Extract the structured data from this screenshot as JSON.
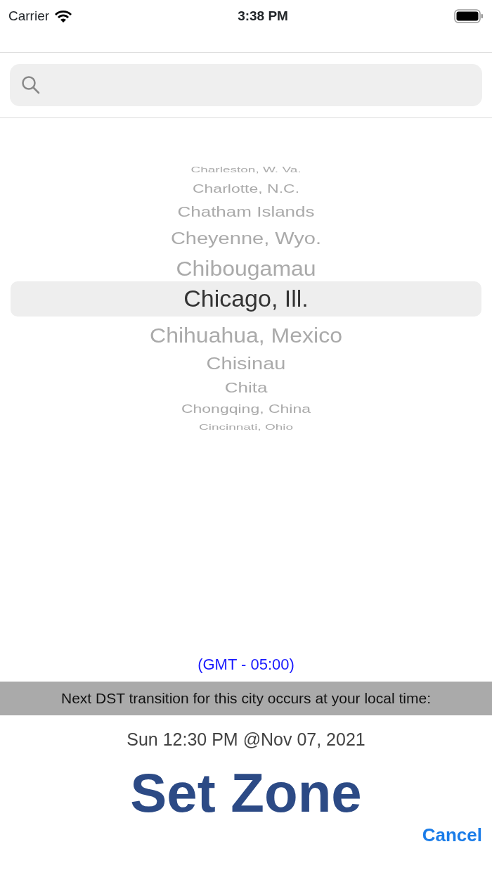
{
  "status_bar": {
    "carrier": "Carrier",
    "time": "3:38 PM"
  },
  "picker": {
    "items": [
      {
        "label": "Charleston, W. Va.",
        "selected": false
      },
      {
        "label": "Charlotte, N.C.",
        "selected": false
      },
      {
        "label": "Chatham Islands",
        "selected": false
      },
      {
        "label": "Cheyenne, Wyo.",
        "selected": false
      },
      {
        "label": "Chibougamau",
        "selected": false
      },
      {
        "label": "Chicago, Ill.",
        "selected": true
      },
      {
        "label": "Chihuahua, Mexico",
        "selected": false
      },
      {
        "label": "Chisinau",
        "selected": false
      },
      {
        "label": "Chita",
        "selected": false
      },
      {
        "label": "Chongqing, China",
        "selected": false
      },
      {
        "label": "Cincinnati, Ohio",
        "selected": false
      }
    ]
  },
  "gmt_offset": "(GMT - 05:00)",
  "dst_banner": "Next DST transition for this city occurs at your local time:",
  "dst_time": "Sun 12:30 PM @Nov 07, 2021",
  "set_button": "Set Zone",
  "cancel_button": "Cancel"
}
